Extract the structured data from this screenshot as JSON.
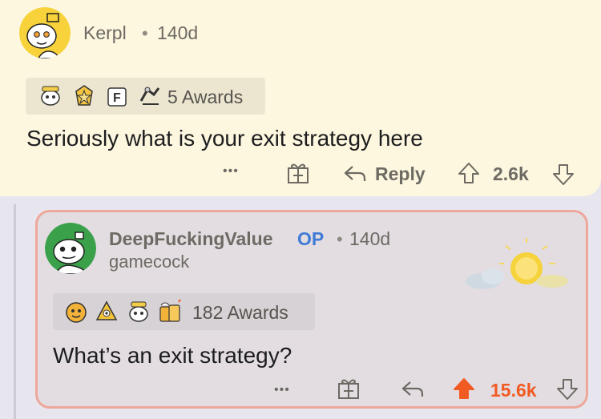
{
  "comment": {
    "username": "Kerpl",
    "separator": "•",
    "age": "140d",
    "awards_label": "5 Awards",
    "body": "Seriously what is your exit strategy here",
    "more_label": "•••",
    "reply_label": "Reply",
    "score": "2.6k"
  },
  "reply": {
    "username": "DeepFuckingValue",
    "op_badge": "OP",
    "separator": "•",
    "age": "140d",
    "flair": "gamecock",
    "awards_label": "182 Awards",
    "body": "What’s an exit strategy?",
    "more_label": "•••",
    "score": "15.6k",
    "upvoted": true
  },
  "colors": {
    "top_bg": "#fdf7df",
    "reply_bg": "#e3dde2",
    "reply_border": "#eea79b",
    "upvote": "#f15a22",
    "op": "#3f7bd6"
  },
  "icons": [
    "snoo-avatar-icon",
    "award-icon",
    "gift-icon",
    "reply-arrow-icon",
    "upvote-arrow-icon",
    "downvote-arrow-icon",
    "more-options-icon",
    "weather-sun-cloud-image"
  ]
}
